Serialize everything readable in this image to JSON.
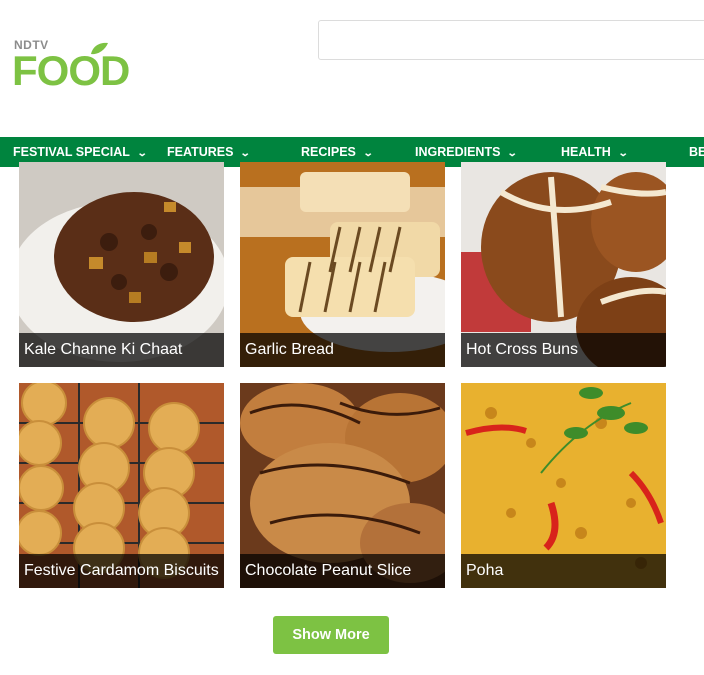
{
  "brand": {
    "top_text": "NDTV",
    "main_text": "FOOD",
    "green": "#7dc243",
    "nav_green": "#00843e"
  },
  "search": {
    "placeholder": ""
  },
  "nav": {
    "items": [
      {
        "label": "FESTIVAL SPECIAL",
        "icon": "chevron-down-icon"
      },
      {
        "label": "FEATURES",
        "icon": "chevron-down-icon"
      },
      {
        "label": "RECIPES",
        "icon": "chevron-down-icon"
      },
      {
        "label": "INGREDIENTS",
        "icon": "chevron-down-icon"
      },
      {
        "label": "HEALTH",
        "icon": "chevron-down-icon"
      },
      {
        "label": "BE"
      }
    ]
  },
  "recipes": [
    {
      "title": "Kale Channe Ki Chaat"
    },
    {
      "title": "Garlic Bread"
    },
    {
      "title": "Hot Cross Buns"
    },
    {
      "title": "Festive Cardamom Biscuits"
    },
    {
      "title": "Chocolate Peanut Slice"
    },
    {
      "title": "Poha"
    }
  ],
  "actions": {
    "show_more_label": "Show More"
  }
}
